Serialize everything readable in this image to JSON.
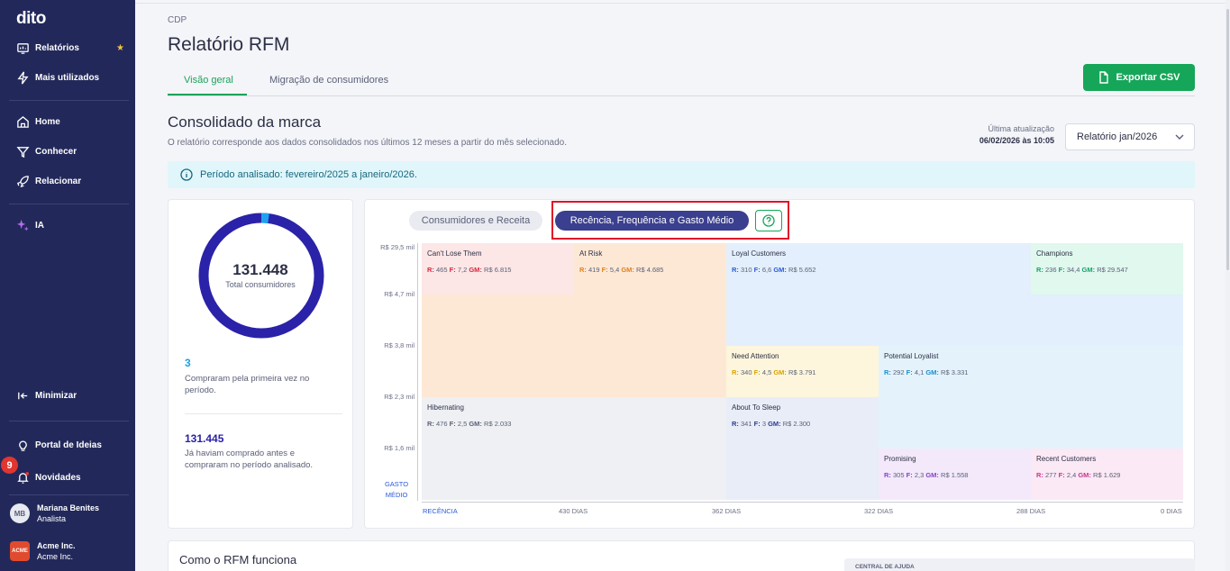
{
  "sidebar": {
    "logo": "dito",
    "items": [
      {
        "label": "Relatórios",
        "icon": "report-icon"
      },
      {
        "label": "Mais utilizados",
        "icon": "lightning-icon"
      },
      {
        "label": "Home",
        "icon": "home-icon"
      },
      {
        "label": "Conhecer",
        "icon": "filter-icon"
      },
      {
        "label": "Relacionar",
        "icon": "rocket-icon"
      },
      {
        "label": "IA",
        "icon": "sparkle-icon"
      }
    ],
    "minimize": "Minimizar",
    "ideas": "Portal de Ideias",
    "news": "Novidades",
    "news_count": "9",
    "user": {
      "initials": "MB",
      "name": "Mariana Benites",
      "role": "Analista"
    },
    "account": {
      "logo_text": "ACME",
      "name": "Acme Inc.",
      "sub": "Acme Inc."
    }
  },
  "header": {
    "breadcrumb": "CDP",
    "title": "Relatório RFM",
    "tabs": [
      {
        "label": "Visão geral",
        "active": true
      },
      {
        "label": "Migração de consumidores",
        "active": false
      }
    ],
    "export_label": "Exportar CSV"
  },
  "section": {
    "title": "Consolidado da marca",
    "subtitle": "O relatório corresponde aos dados consolidados nos últimos 12 meses a partir do mês selecionado.",
    "update_label": "Última atualização",
    "update_value": "06/02/2026 às 10:05",
    "period_select": "Relatório jan/2026",
    "info": "Período analisado: fevereiro/2025 a janeiro/2026."
  },
  "summary": {
    "total": "131.448",
    "total_label": "Total consumidores",
    "new_count": "3",
    "new_label": "Compraram pela primeira vez no período.",
    "returning_count": "131.445",
    "returning_label": "Já haviam comprado antes e compraram no período analisado.",
    "new_fraction": 2e-05
  },
  "rfm": {
    "tabs": [
      "Consumidores e Receita",
      "Recência, Frequência e Gasto Médio"
    ],
    "active_tab": 1,
    "y_ticks": [
      "R$ 29,5 mil",
      "R$ 4,7 mil",
      "R$ 3,8 mil",
      "R$ 2,3 mil",
      "R$ 1,6 mil"
    ],
    "y_axis_label_1": "GASTO",
    "y_axis_label_2": "MÉDIO",
    "x_axis_label": "RECÊNCIA",
    "x_ticks": [
      "430 DIAS",
      "362 DIAS",
      "322 DIAS",
      "288 DIAS",
      "0 DIAS"
    ],
    "segments": [
      {
        "name": "Can't Lose Them",
        "r": "465",
        "f": "7,2",
        "gm": "R$ 6.815",
        "color": "#fde6e6",
        "accent": "#d7263d"
      },
      {
        "name": "At Risk",
        "r": "419",
        "f": "5,4",
        "gm": "R$ 4.685",
        "color": "#fde8d6",
        "accent": "#e0801a"
      },
      {
        "name": "Loyal Customers",
        "r": "310",
        "f": "6,6",
        "gm": "R$ 5.652",
        "color": "#e3effc",
        "accent": "#2a5bd7"
      },
      {
        "name": "Champions",
        "r": "236",
        "f": "34,4",
        "gm": "R$ 29.547",
        "color": "#e0f8ee",
        "accent": "#17a06b"
      },
      {
        "name": "Need Attention",
        "r": "340",
        "f": "4,5",
        "gm": "R$ 3.791",
        "color": "#fdf6dc",
        "accent": "#d9a300"
      },
      {
        "name": "Potential Loyalist",
        "r": "292",
        "f": "4,1",
        "gm": "R$ 3.331",
        "color": "#e4f3fb",
        "accent": "#1a8ecb"
      },
      {
        "name": "Hibernating",
        "r": "476",
        "f": "2,5",
        "gm": "R$ 2.033",
        "color": "#eef0f3",
        "accent": "#5b6078"
      },
      {
        "name": "About To Sleep",
        "r": "341",
        "f": "3",
        "gm": "R$ 2.300",
        "color": "#e8edf8",
        "accent": "#2c3c8c"
      },
      {
        "name": "Promising",
        "r": "305",
        "f": "2,3",
        "gm": "R$ 1.558",
        "color": "#f3e9fb",
        "accent": "#8a3fc7"
      },
      {
        "name": "Recent Customers",
        "r": "277",
        "f": "2,4",
        "gm": "R$ 1.629",
        "color": "#fbe9f5",
        "accent": "#c7358f"
      }
    ]
  },
  "bottom": {
    "title": "Como o RFM funciona",
    "help": "CENTRAL DE AJUDA"
  }
}
